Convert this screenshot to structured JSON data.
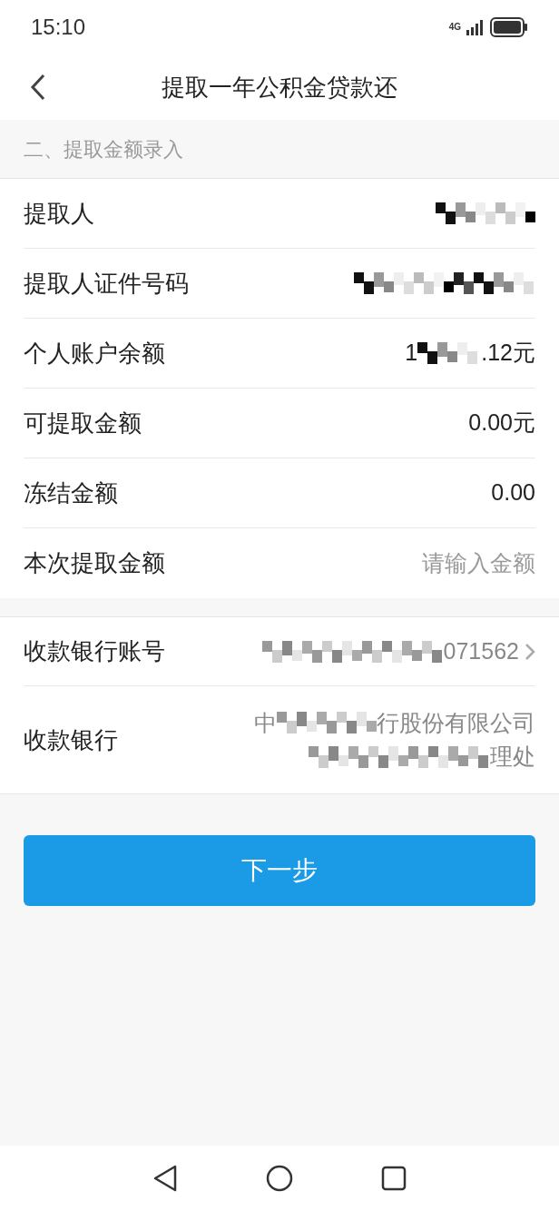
{
  "status_bar": {
    "time": "15:10",
    "network": "4G"
  },
  "header": {
    "title": "提取一年公积金贷款还"
  },
  "section": {
    "title": "二、提取金额录入"
  },
  "rows": [
    {
      "label": "提取人",
      "kind": "value",
      "parts": [
        {
          "kind": "mosaic_medium"
        }
      ]
    },
    {
      "label": "提取人证件号码",
      "kind": "value",
      "parts": [
        {
          "kind": "mosaic_long"
        }
      ]
    },
    {
      "label": "个人账户余额",
      "kind": "value",
      "parts": [
        {
          "kind": "text",
          "text": "1"
        },
        {
          "kind": "mosaic_small"
        },
        {
          "kind": "text",
          "text": ".12元"
        }
      ]
    },
    {
      "label": "可提取金额",
      "kind": "value",
      "parts": [
        {
          "kind": "text",
          "text": "0.00元"
        }
      ]
    },
    {
      "label": "冻结金额",
      "kind": "value",
      "parts": [
        {
          "kind": "text",
          "text": "0.00"
        }
      ]
    },
    {
      "label": "本次提取金额",
      "kind": "input",
      "placeholder": "请输入金额"
    }
  ],
  "bank_rows": [
    {
      "label": "收款银行账号",
      "kind": "link",
      "lines": [
        [
          {
            "kind": "mosaic_long"
          },
          {
            "kind": "text",
            "text": "071562"
          }
        ]
      ]
    },
    {
      "label": "收款银行",
      "kind": "value",
      "lines": [
        [
          {
            "kind": "text",
            "text": "中"
          },
          {
            "kind": "mosaic_medium"
          },
          {
            "kind": "text",
            "text": "行股份有限公司"
          }
        ],
        [
          {
            "kind": "mosaic_long"
          },
          {
            "kind": "text",
            "text": "理处"
          }
        ]
      ]
    }
  ],
  "next_button": "下一步"
}
